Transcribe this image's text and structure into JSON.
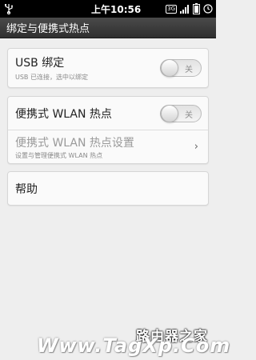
{
  "status_bar": {
    "time": "上午10:56",
    "network": "3G"
  },
  "title": "绑定与便携式热点",
  "usb": {
    "label": "USB 绑定",
    "sub": "USB 已连接，选中以绑定",
    "toggle_state": "关"
  },
  "wlan": {
    "label": "便携式 WLAN 热点",
    "toggle_state": "关",
    "settings_label": "便携式 WLAN 热点设置",
    "settings_sub": "设置与管理便携式 WLAN 热点"
  },
  "help": {
    "label": "帮助"
  },
  "watermark": {
    "line1": "路由器之家",
    "line2": "Www.TagXp.Com"
  }
}
